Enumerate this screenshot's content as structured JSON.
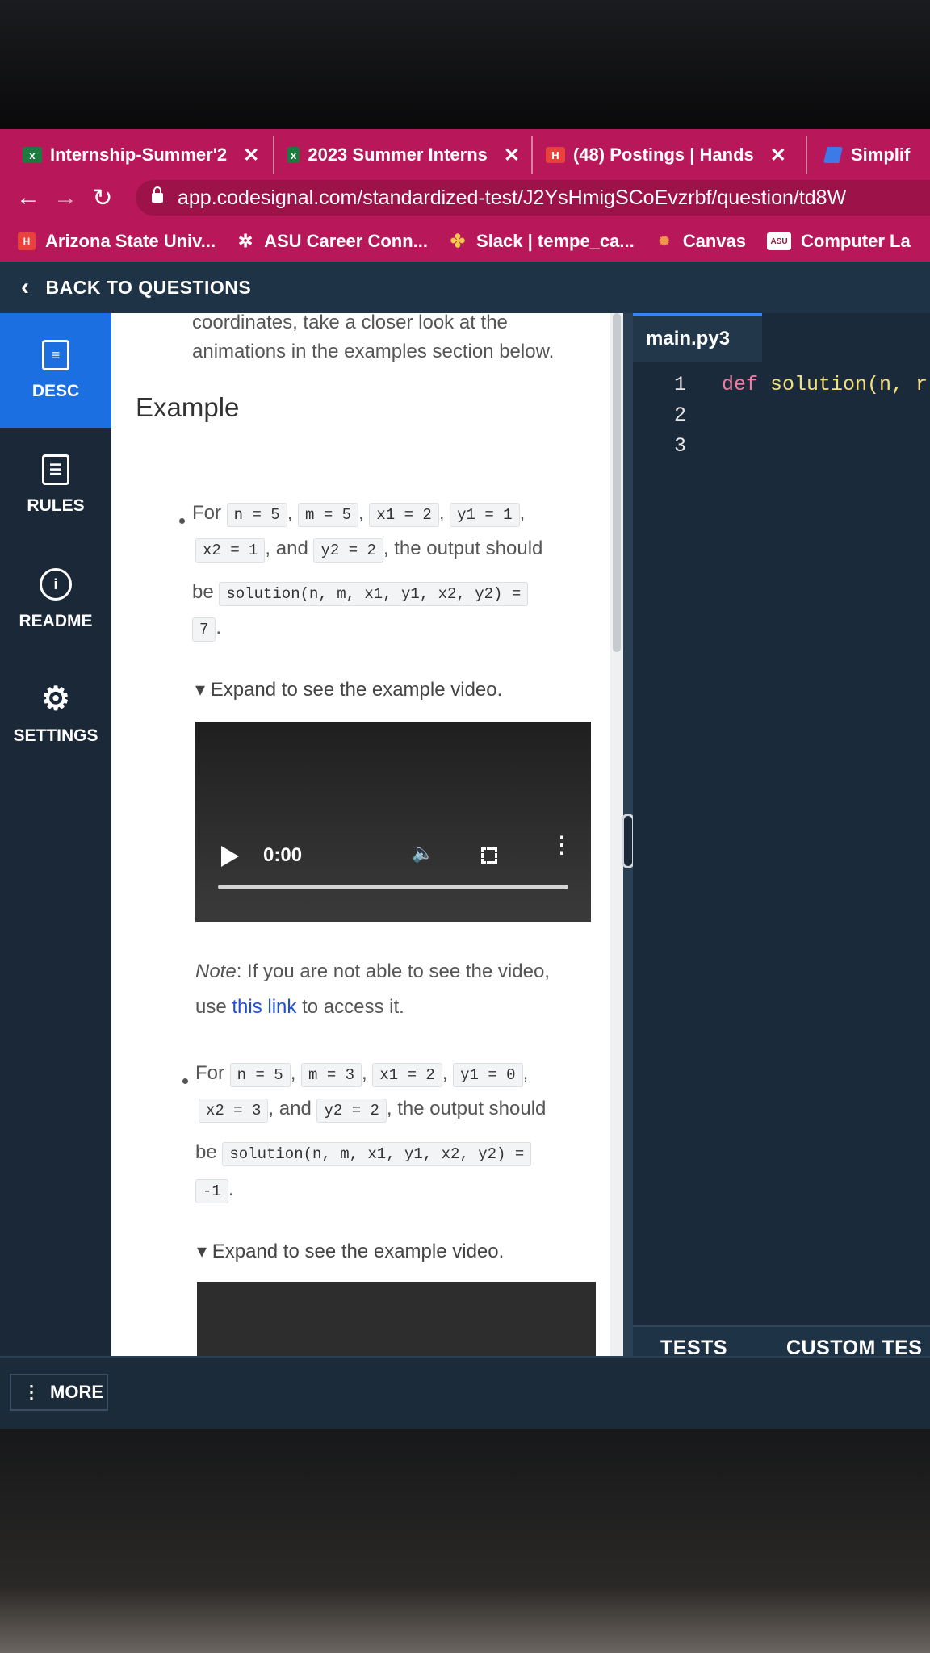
{
  "browser": {
    "tabs": [
      {
        "label": "Internship-Summer'2",
        "icon": "excel-icon"
      },
      {
        "label": "2023 Summer Interns",
        "icon": "excel-icon"
      },
      {
        "label": "(48) Postings | Hands",
        "icon": "handshake-icon"
      },
      {
        "label": "Simplif",
        "icon": "simplify-icon"
      }
    ],
    "url": "app.codesignal.com/standardized-test/J2YsHmigSCoEvzrbf/question/td8W",
    "bookmarks": [
      {
        "label": "Arizona State Univ...",
        "icon": "handshake-icon"
      },
      {
        "label": "ASU Career Conn...",
        "icon": "gear-icon"
      },
      {
        "label": "Slack | tempe_ca...",
        "icon": "slack-icon"
      },
      {
        "label": "Canvas",
        "icon": "canvas-icon"
      },
      {
        "label": "Computer La",
        "icon": "asu-icon"
      }
    ],
    "colors": {
      "chrome": "#b8185a"
    }
  },
  "app": {
    "back_label": "BACK TO QUESTIONS",
    "nav": [
      {
        "label": "DESC",
        "icon": "document-icon",
        "active": true
      },
      {
        "label": "RULES",
        "icon": "list-icon",
        "active": false
      },
      {
        "label": "README",
        "icon": "info-icon",
        "active": false
      },
      {
        "label": "SETTINGS",
        "icon": "gear-icon",
        "active": false
      }
    ],
    "more_label": "MORE"
  },
  "description": {
    "top_text_1": "coordinates, take a closer look at the",
    "top_text_2": "animations in the examples section below.",
    "heading": "Example",
    "example1": {
      "for": "For",
      "n": "n = 5",
      "m": "m = 5",
      "x1": "x1 = 2",
      "y1": "y1 = 1",
      "x2": "x2 = 1",
      "and": ", and",
      "y2": "y2 = 2",
      "output_text": ", the output should",
      "be": "be",
      "call": "solution(n, m, x1, y1, x2, y2) =",
      "result": "7"
    },
    "video_summary": "Expand to see the example video.",
    "video_time": "0:00",
    "note_label": "Note",
    "note_text": ": If you are not able to see the video,",
    "note_use": "use",
    "note_link": "this link",
    "note_end": "to access it.",
    "example2": {
      "for": "For",
      "n": "n = 5",
      "m": "m = 3",
      "x1": "x1 = 2",
      "y1": "y1 = 0",
      "x2": "x2 = 3",
      "and": ", and",
      "y2": "y2 = 2",
      "output_text": ", the output should",
      "be": "be",
      "call": "solution(n, m, x1, y1, x2, y2) =",
      "result": "-1"
    },
    "video_summary_2": "Expand to see the example video."
  },
  "editor": {
    "file_tab": "main.py3",
    "line_numbers": [
      "1",
      "2",
      "3"
    ],
    "code_keyword": "def",
    "code_function": "solution(n, r",
    "bottom_tabs": [
      "TESTS",
      "CUSTOM TES"
    ]
  }
}
